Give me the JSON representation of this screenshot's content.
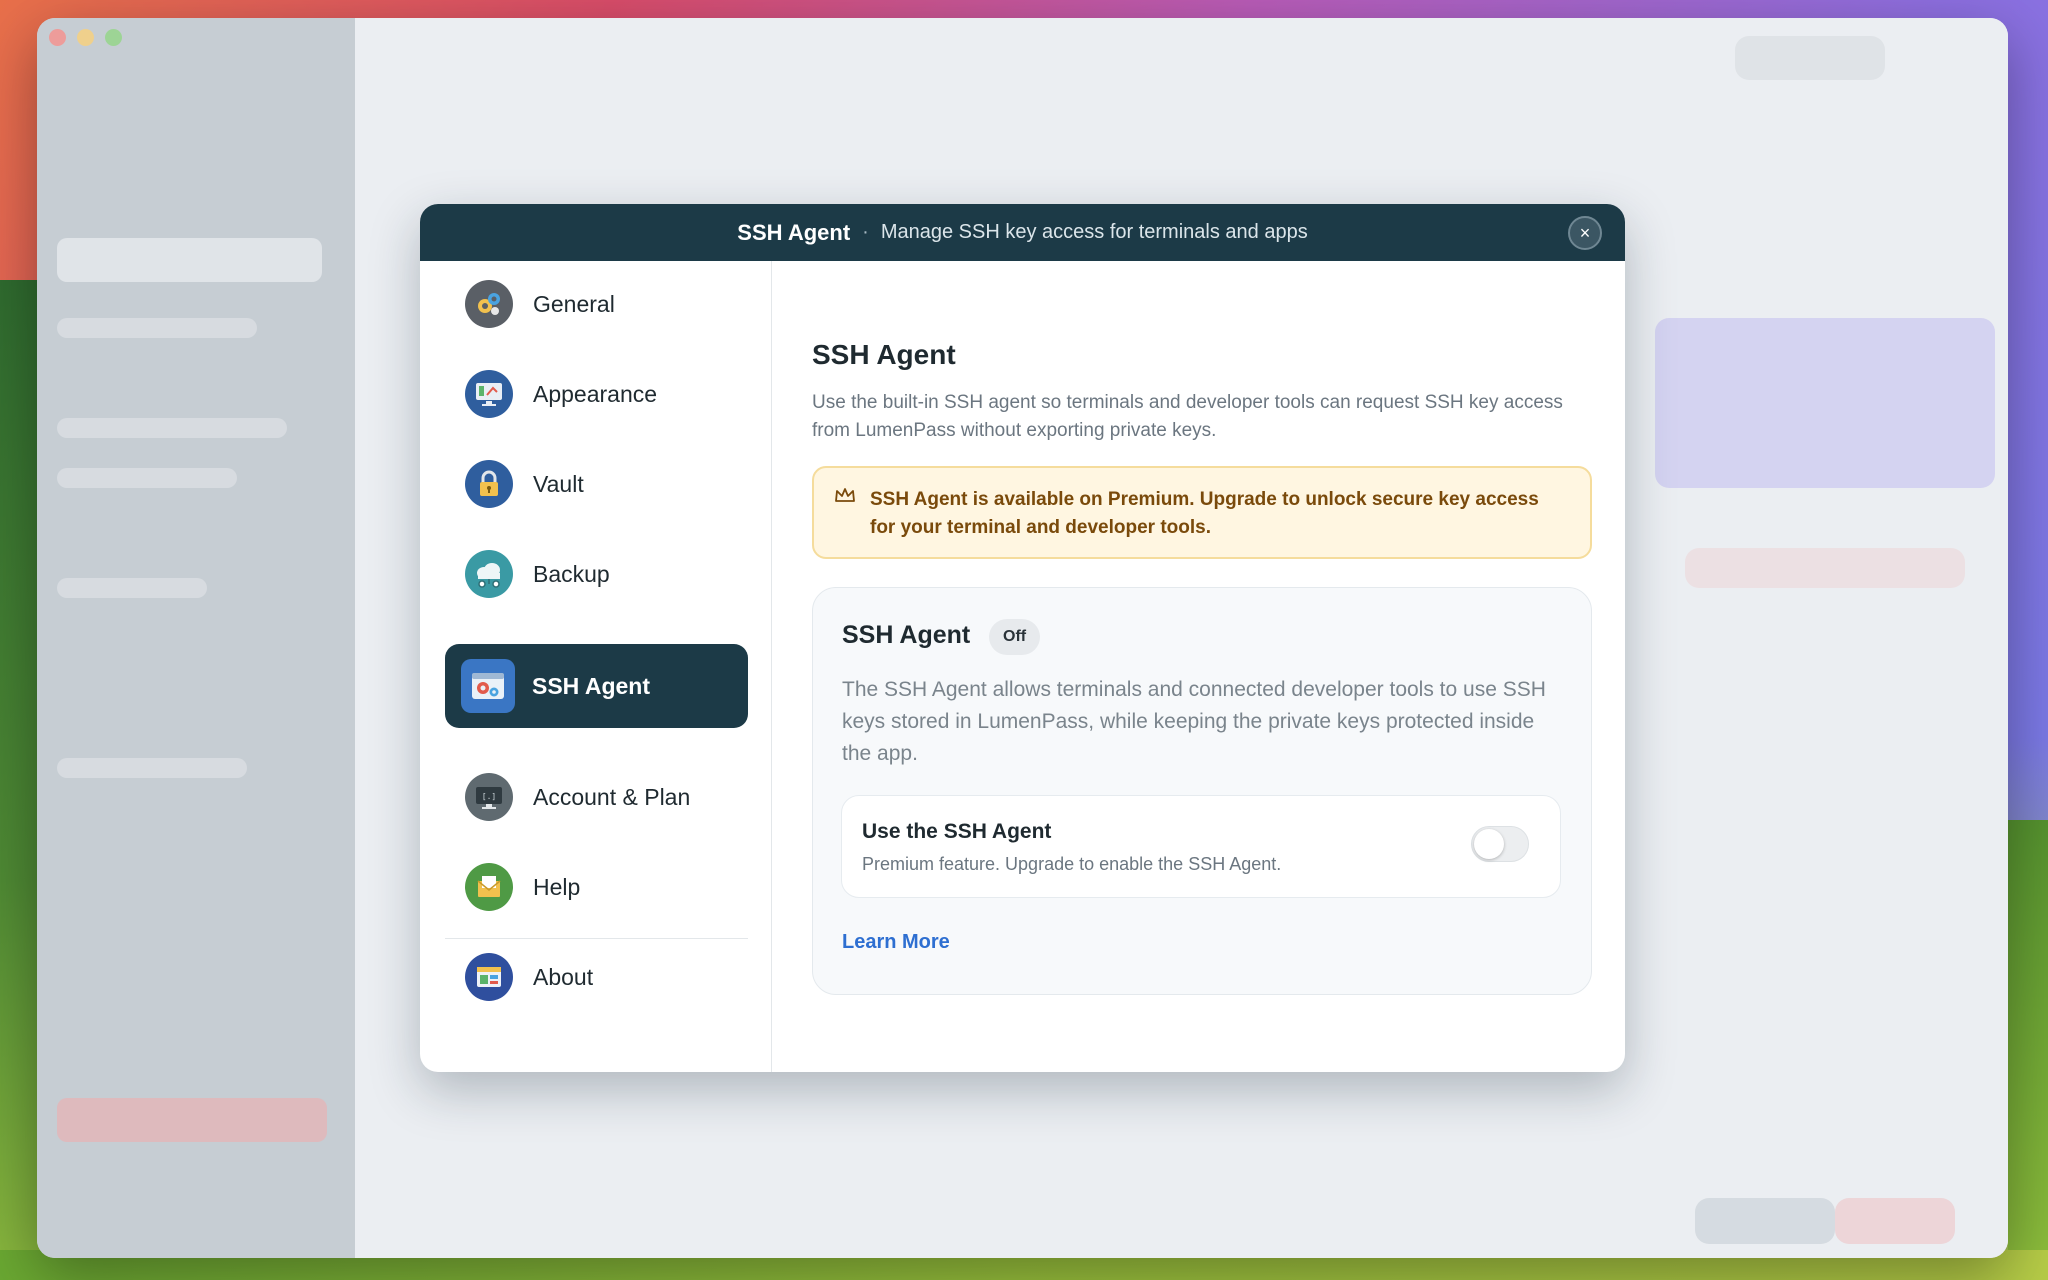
{
  "dialog": {
    "title": "SSH Agent",
    "separator": "·",
    "subtitle": "Manage SSH key access for terminals and apps",
    "close_symbol": "×"
  },
  "nav": {
    "items": [
      {
        "label": "General",
        "icon": "general-gears-icon",
        "color": "#5a5f66"
      },
      {
        "label": "Appearance",
        "icon": "appearance-monitor-icon",
        "color": "#2f5e9e"
      },
      {
        "label": "Vault",
        "icon": "lock-icon",
        "color": "#2f5e9e"
      },
      {
        "label": "Backup",
        "icon": "cloud-backup-icon",
        "color": "#3a9aa4"
      },
      {
        "label": "SSH Agent",
        "icon": "ssh-window-gear-icon",
        "color": "#3a76c4",
        "active": true
      },
      {
        "label": "Account & Plan",
        "icon": "account-monitor-icon",
        "color": "#5f6a70"
      },
      {
        "label": "Help",
        "icon": "help-envelope-icon",
        "color": "#4f9a45"
      },
      {
        "label": "About",
        "icon": "about-window-icon",
        "color": "#2f4f9e"
      }
    ]
  },
  "content": {
    "title": "SSH Agent",
    "description": "Use the built-in SSH agent so terminals and developer tools can request SSH key access from LumenPass without exporting private keys.",
    "premium_banner": {
      "icon": "crown-icon",
      "text": "SSH Agent is available on Premium. Upgrade to unlock secure key access for your terminal and developer tools."
    },
    "card": {
      "title": "SSH Agent",
      "status": "Off",
      "description": "The SSH Agent allows terminals and connected developer tools to use SSH keys stored in LumenPass, while keeping the private keys protected inside the app.",
      "toggle_label": "Use the SSH Agent",
      "toggle_hint": "Premium feature. Upgrade to enable the SSH Agent.",
      "toggle_on": false,
      "learn_more": "Learn More"
    }
  },
  "colors": {
    "header_bg": "#1c3a47",
    "active_nav_bg": "#1c3a47",
    "link": "#2e6fd1",
    "banner_bg": "#fff6e1",
    "banner_text": "#7a4a0b"
  }
}
